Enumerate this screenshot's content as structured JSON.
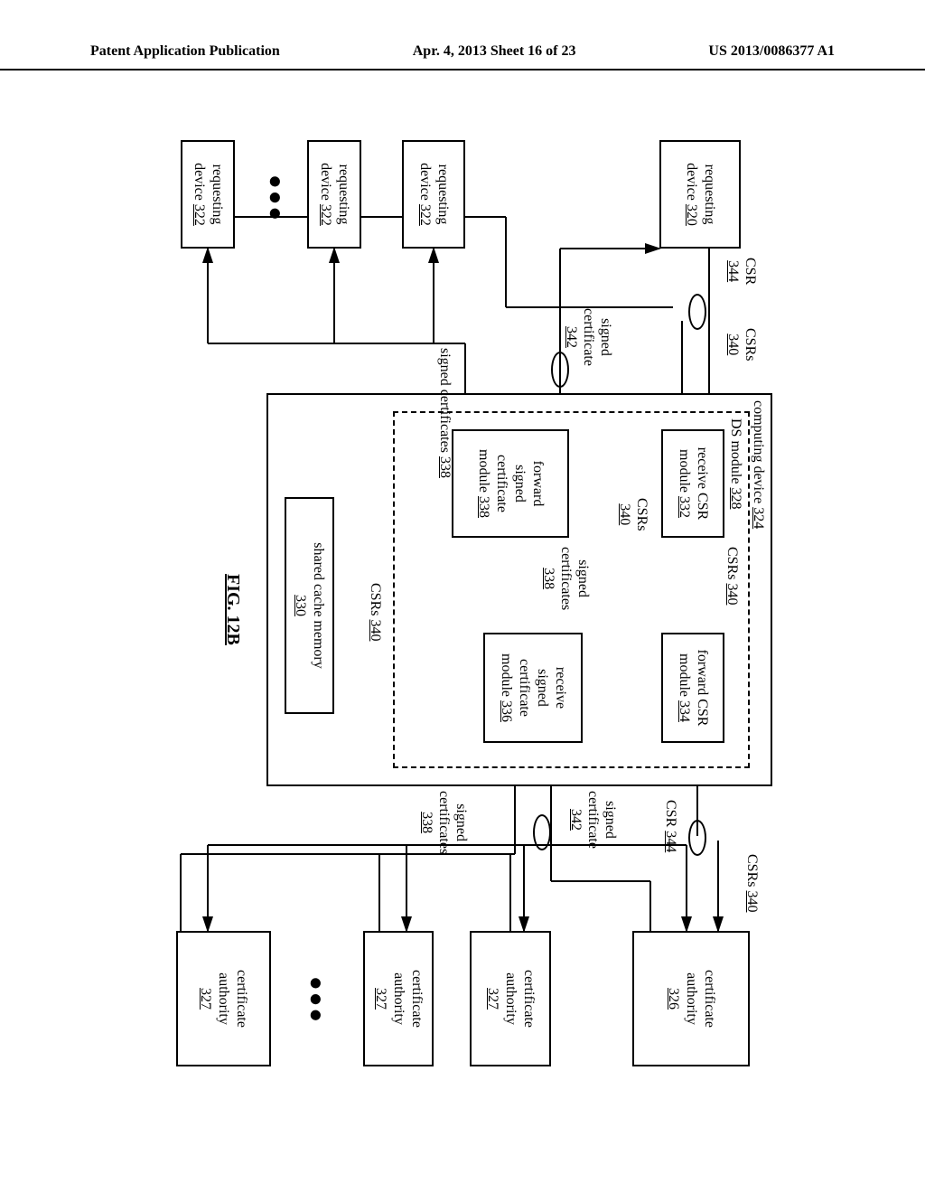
{
  "header": {
    "left": "Patent Application Publication",
    "center": "Apr. 4, 2013  Sheet 16 of 23",
    "right": "US 2013/0086377 A1"
  },
  "figure_label": "FIG. 12B",
  "boxes": {
    "req320": {
      "line1": "requesting",
      "line2": "device",
      "num": "320"
    },
    "req322a": {
      "line1": "requesting",
      "line2": "device",
      "num": "322"
    },
    "req322b": {
      "line1": "requesting",
      "line2": "device",
      "num": "322"
    },
    "req322c": {
      "line1": "requesting",
      "line2": "device",
      "num": "322"
    },
    "computing_device": {
      "label": "computing device",
      "num": "324"
    },
    "ds_module": {
      "label": "DS module",
      "num": "328"
    },
    "recv_csr": {
      "line1": "receive CSR",
      "line2": "module",
      "num": "332"
    },
    "fwd_csr": {
      "line1": "forward CSR",
      "line2": "module",
      "num": "334"
    },
    "recv_signed": {
      "line1": "receive",
      "line2": "signed",
      "line3": "certificate",
      "line4": "module",
      "num": "336"
    },
    "fwd_signed": {
      "line1": "forward",
      "line2": "signed",
      "line3": "certificate",
      "line4": "module",
      "num": "338"
    },
    "shared_cache": {
      "line1": "shared cache memory",
      "num": "330"
    },
    "ca326": {
      "line1": "certificate",
      "line2": "authority",
      "num": "326"
    },
    "ca327a": {
      "line1": "certificate",
      "line2": "authority",
      "num": "327"
    },
    "ca327b": {
      "line1": "certificate",
      "line2": "authority",
      "num": "327"
    },
    "ca327c": {
      "line1": "certificate",
      "line2": "authority",
      "num": "327"
    }
  },
  "labels": {
    "csr344_left": {
      "line1": "CSR",
      "num": "344"
    },
    "csrs340_left": {
      "line1": "CSRs",
      "num": "340"
    },
    "signed342_left": {
      "line1": "signed",
      "line2": "certificate",
      "num": "342"
    },
    "signed338_left": {
      "line1": "signed certificates",
      "num": "338"
    },
    "csrs340_top_inner": {
      "line1": "CSRs",
      "num": "340"
    },
    "csrs340_mid_inner": {
      "line1": "CSRs",
      "num": "340"
    },
    "signed338_inner": {
      "line1": "signed",
      "line2": "certificates",
      "num": "338"
    },
    "csrs340_cache": {
      "line1": "CSRs",
      "num": "340"
    },
    "csrs340_right": {
      "line1": "CSRs",
      "num": "340"
    },
    "csr344_right": {
      "line1": "CSR",
      "num": "344"
    },
    "signed342_right": {
      "line1": "signed",
      "line2": "certificate",
      "num": "342"
    },
    "signed338_right": {
      "line1": "signed",
      "line2": "certificates",
      "num": "338"
    }
  }
}
